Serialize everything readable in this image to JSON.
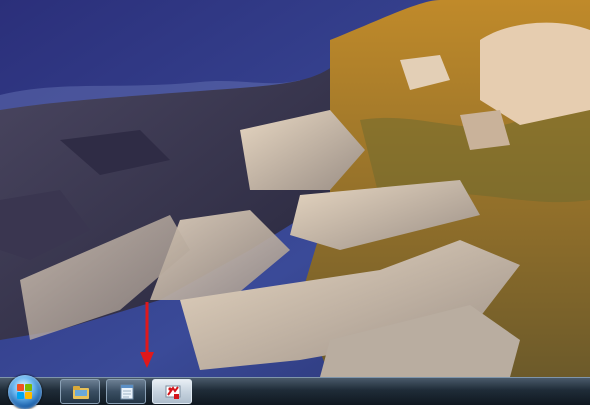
{
  "desktop": {
    "wallpaper": "coastal-rocks-sunset",
    "annotation_arrow_color": "#e0181b"
  },
  "taskbar": {
    "start_button": {
      "icon": "windows-logo-icon"
    },
    "pinned": [
      {
        "name": "windows-explorer",
        "icon": "folder-icon"
      },
      {
        "name": "notepad",
        "icon": "notepad-icon"
      },
      {
        "name": "paint",
        "icon": "paint-icon",
        "active": true
      }
    ]
  }
}
